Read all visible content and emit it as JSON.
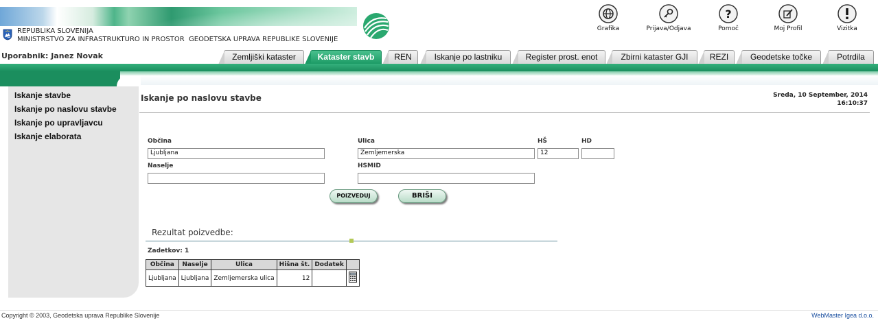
{
  "header": {
    "org_line1": "REPUBLIKA SLOVENIJA",
    "org_line2": "MINISTRSTVO ZA INFRASTRUKTURO IN PROSTOR",
    "org_line3": "GEODETSKA UPRAVA REPUBLIKE SLOVENIJE",
    "user": "Uporabnik: Janez Novak",
    "toolbar": [
      {
        "label": "Grafika",
        "icon": "globe-icon"
      },
      {
        "label": "Prijava/Odjava",
        "icon": "key-icon"
      },
      {
        "label": "Pomoč",
        "icon": "help-icon"
      },
      {
        "label": "Moj Profil",
        "icon": "edit-profile-icon"
      },
      {
        "label": "Vizitka",
        "icon": "info-icon"
      }
    ],
    "tabs": [
      {
        "label": "Zemljiški kataster"
      },
      {
        "label": "Kataster stavb",
        "active": true
      },
      {
        "label": "REN"
      },
      {
        "label": "Iskanje po lastniku"
      },
      {
        "label": "Register prost. enot"
      },
      {
        "label": "Zbirni kataster GJI"
      },
      {
        "label": "REZI"
      },
      {
        "label": "Geodetske točke"
      },
      {
        "label": "Potrdila"
      }
    ]
  },
  "sidebar": {
    "items": [
      {
        "label": "Iskanje stavbe"
      },
      {
        "label": "Iskanje po naslovu stavbe"
      },
      {
        "label": "Iskanje po upravljavcu"
      },
      {
        "label": "Iskanje elaborata"
      }
    ]
  },
  "main": {
    "title": "Iskanje po naslovu stavbe",
    "date_line1": "Sreda, 10 September, 2014",
    "date_line2": "16:10:37",
    "form": {
      "obcina_label": "Občina",
      "obcina_value": "Ljubljana",
      "ulica_label": "Ulica",
      "ulica_value": "Zemljemerska",
      "hs_label": "HŠ",
      "hs_value": "12",
      "hd_label": "HD",
      "hd_value": "",
      "naselje_label": "Naselje",
      "naselje_value": "",
      "hsmid_label": "HSMID",
      "hsmid_value": "",
      "search_button": "POIZVEDUJ",
      "clear_button": "BRIŠI"
    },
    "results": {
      "title": "Rezultat poizvedbe:",
      "hits": "Zadetkov: 1",
      "columns": [
        "Občina",
        "Naselje",
        "Ulica",
        "Hišna št.",
        "Dodatek"
      ],
      "rows": [
        [
          "Ljubljana",
          "Ljubljana",
          "Zemljemerska ulica",
          "12",
          ""
        ]
      ]
    }
  },
  "footer": {
    "copyright": "Copyright © 2003, Geodetska uprava Republike Slovenije",
    "webmaster": "WebMaster Igea d.o.o."
  }
}
